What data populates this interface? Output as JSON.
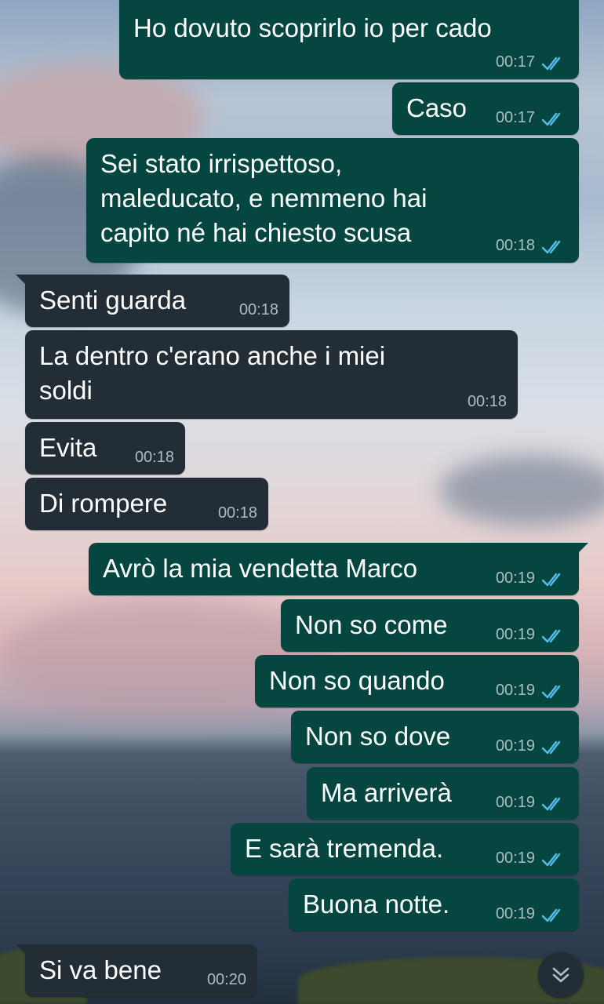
{
  "messages": [
    {
      "text": "Ho dovuto scoprirlo io per cado",
      "time": "00:17",
      "direction": "outgoing",
      "status": "read"
    },
    {
      "text": "Caso",
      "time": "00:17",
      "direction": "outgoing",
      "status": "read"
    },
    {
      "text": "Sei stato irrispettoso,\nmaleducato, e nemmeno hai\ncapito né hai chiesto scusa",
      "time": "00:18",
      "direction": "outgoing",
      "status": "read"
    },
    {
      "text": "Senti guarda",
      "time": "00:18",
      "direction": "incoming"
    },
    {
      "text": "La dentro c'erano anche i miei\nsoldi",
      "time": "00:18",
      "direction": "incoming"
    },
    {
      "text": "Evita",
      "time": "00:18",
      "direction": "incoming"
    },
    {
      "text": "Di rompere",
      "time": "00:18",
      "direction": "incoming"
    },
    {
      "text": "Avrò la mia vendetta Marco",
      "time": "00:19",
      "direction": "outgoing",
      "status": "read"
    },
    {
      "text": "Non so come",
      "time": "00:19",
      "direction": "outgoing",
      "status": "read"
    },
    {
      "text": "Non so quando",
      "time": "00:19",
      "direction": "outgoing",
      "status": "read"
    },
    {
      "text": "Non so dove",
      "time": "00:19",
      "direction": "outgoing",
      "status": "read"
    },
    {
      "text": "Ma arriverà",
      "time": "00:19",
      "direction": "outgoing",
      "status": "read"
    },
    {
      "text": "E sarà tremenda.",
      "time": "00:19",
      "direction": "outgoing",
      "status": "read"
    },
    {
      "text": "Buona notte.",
      "time": "00:19",
      "direction": "outgoing",
      "status": "read"
    },
    {
      "text": "Si va bene",
      "time": "00:20",
      "direction": "incoming"
    }
  ],
  "icons": {
    "read_receipt": "double-check-icon",
    "scroll_down": "chevron-double-down-icon"
  },
  "colors": {
    "outgoing_bubble": "#054740",
    "incoming_bubble": "#222d35",
    "read_tick": "#53bdeb",
    "timestamp": "#aebdc0"
  }
}
